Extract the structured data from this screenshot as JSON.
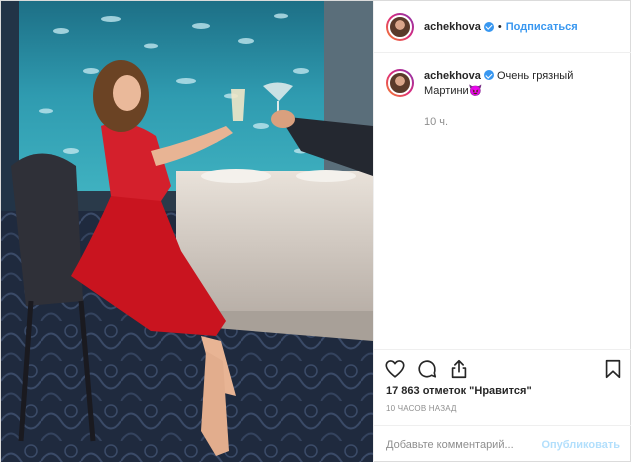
{
  "post": {
    "author": "achekhova",
    "verified": true,
    "separator": "•",
    "follow_label": "Подписаться",
    "caption": "Очень грязный Мартини😈",
    "time_ago": "10 ч.",
    "likes_text": "17 863 отметок \"Нравится\"",
    "posted_text": "10 ЧАСОВ НАЗАД"
  },
  "comment_box": {
    "placeholder": "Добавьте комментарий...",
    "publish_label": "Опубликовать"
  },
  "icons": {
    "like": "heart-icon",
    "comment": "comment-icon",
    "share": "share-icon",
    "save": "bookmark-icon"
  },
  "colors": {
    "link_blue": "#3897f0",
    "publish_disabled": "#b2dffc",
    "muted_text": "#8e8e8e",
    "border": "#efefef"
  }
}
